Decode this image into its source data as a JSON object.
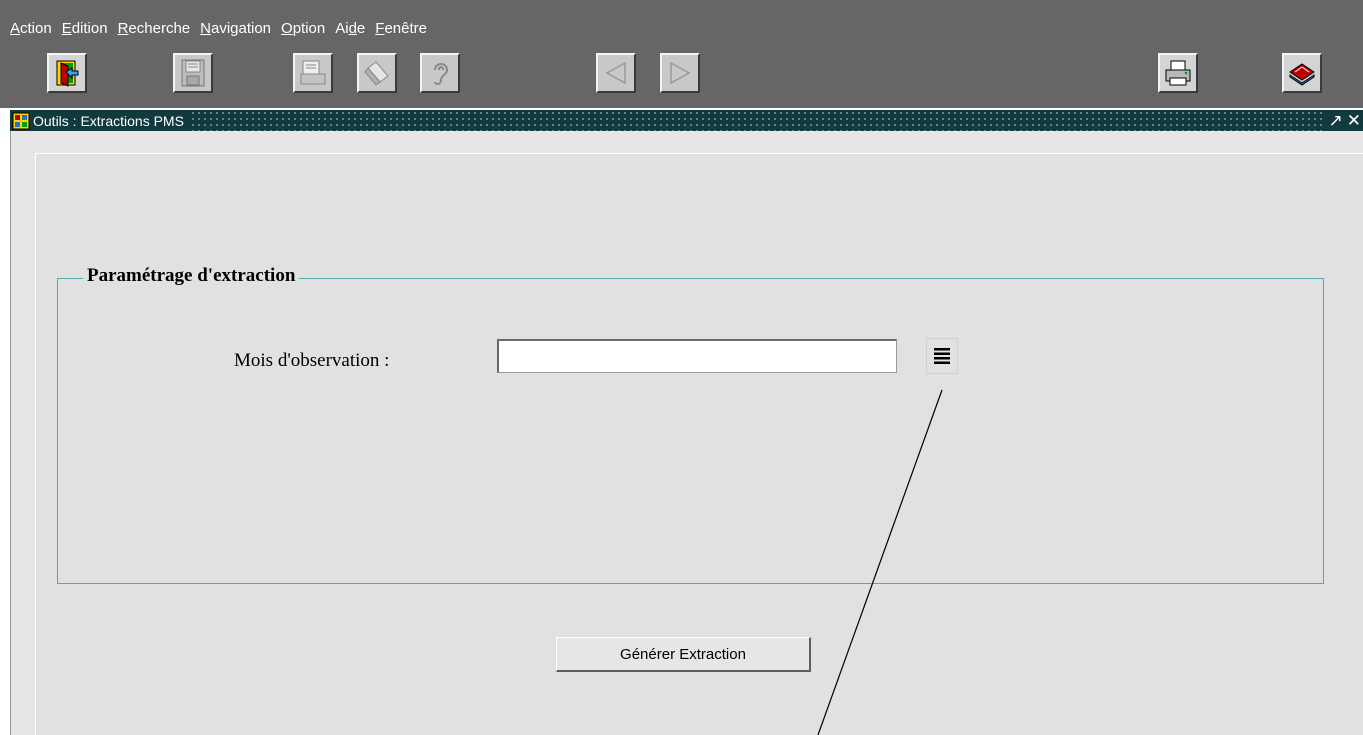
{
  "menu": [
    {
      "mnemonic": "A",
      "rest": "ction"
    },
    {
      "mnemonic": "E",
      "rest": "dition"
    },
    {
      "mnemonic": "R",
      "rest": "echerche"
    },
    {
      "mnemonic": "N",
      "rest": "avigation"
    },
    {
      "mnemonic": "O",
      "rest": "ption"
    },
    {
      "prefix": "Ai",
      "mnemonic": "d",
      "rest": "e"
    },
    {
      "mnemonic": "F",
      "rest": "enêtre"
    }
  ],
  "toolbar": {
    "exit_icon": "exit-door-icon",
    "save_icon": "floppy-disk-icon",
    "print_preview_icon": "print-document-icon",
    "clear_icon": "eraser-icon",
    "help_icon": "help-ear-icon",
    "prev_icon": "triangle-left-icon",
    "next_icon": "triangle-right-icon",
    "print_icon": "printer-icon",
    "book_icon": "book-icon"
  },
  "window": {
    "title": "Outils : Extractions PMS",
    "maximize_glyph": "↗",
    "close_glyph": "✕"
  },
  "form": {
    "group_title": "Paramétrage d'extraction",
    "field_label": "Mois d'observation :",
    "field_value": "",
    "lov_icon": "list-of-values-icon",
    "generate_label": "Générer Extraction"
  },
  "colors": {
    "menubar_bg": "#666666",
    "titlebar_bg": "#103a3d",
    "canvas_bg": "#e1e1e1",
    "groupbox_border": "#5aa8a8"
  }
}
